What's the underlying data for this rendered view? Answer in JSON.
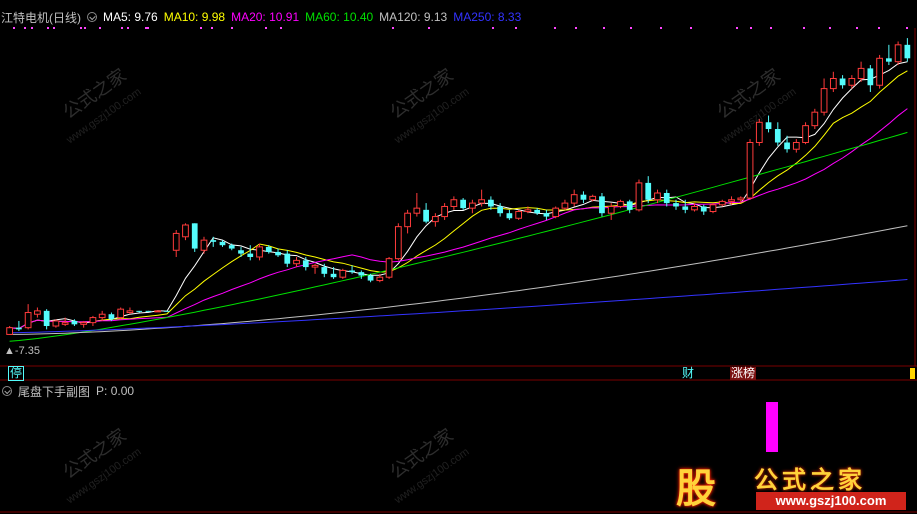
{
  "header": {
    "stock_name": "江特电机(日线)",
    "ma5": "MA5: 9.76",
    "ma10": "MA10: 9.98",
    "ma20": "MA20: 10.91",
    "ma60": "MA60: 10.40",
    "ma120": "MA120: 9.13",
    "ma250": "MA250: 8.33"
  },
  "colors": {
    "ma5": "#ffffff",
    "ma10": "#ffff00",
    "ma20": "#ff00ff",
    "ma60": "#00e000",
    "ma120": "#c0c0c0",
    "ma250": "#3333ff",
    "up": "#ff3b3b",
    "down": "#54fcfc",
    "grid": "#7a0000"
  },
  "price_marker": "7.35",
  "tags": {
    "left": "停",
    "cai": "财",
    "zhangbang": "涨榜"
  },
  "sub_panel": {
    "title": "尾盘下手副图",
    "value": "P: 0.00"
  },
  "watermark": {
    "text": "公式之家",
    "url": "www.gszj100.com"
  },
  "logo": {
    "char": "股",
    "text": "公式之家",
    "url": "www.gszj100.com"
  },
  "chart_data": {
    "type": "candlestick",
    "ohlc": [
      [
        7.3,
        7.55,
        7.3,
        7.5
      ],
      [
        7.5,
        7.7,
        7.4,
        7.45
      ],
      [
        7.5,
        8.2,
        7.45,
        7.95
      ],
      [
        7.9,
        8.1,
        7.8,
        8.0
      ],
      [
        8.0,
        8.05,
        7.45,
        7.55
      ],
      [
        7.55,
        7.75,
        7.5,
        7.7
      ],
      [
        7.6,
        7.8,
        7.55,
        7.65
      ],
      [
        7.7,
        7.75,
        7.55,
        7.6
      ],
      [
        7.6,
        7.7,
        7.5,
        7.65
      ],
      [
        7.65,
        7.85,
        7.55,
        7.8
      ],
      [
        7.8,
        8.0,
        7.7,
        7.9
      ],
      [
        7.9,
        7.95,
        7.7,
        7.75
      ],
      [
        7.8,
        8.1,
        7.75,
        8.05
      ],
      [
        7.95,
        8.1,
        7.9,
        8.0
      ],
      [
        8.0,
        8.0,
        7.95,
        7.98
      ],
      [
        8.0,
        8.0,
        7.98,
        7.99
      ],
      [
        8.0,
        8.0,
        7.99,
        8.0
      ],
      [
        8.0,
        8.0,
        7.99,
        7.99
      ],
      [
        9.8,
        10.4,
        9.6,
        10.3
      ],
      [
        10.2,
        10.6,
        10.1,
        10.55
      ],
      [
        10.6,
        10.6,
        9.75,
        9.85
      ],
      [
        9.8,
        10.2,
        9.7,
        10.1
      ],
      [
        10.1,
        10.2,
        9.9,
        10.05
      ],
      [
        10.05,
        10.1,
        9.9,
        9.95
      ],
      [
        9.95,
        10.0,
        9.8,
        9.85
      ],
      [
        9.8,
        9.9,
        9.6,
        9.7
      ],
      [
        9.7,
        9.95,
        9.5,
        9.6
      ],
      [
        9.6,
        10.0,
        9.5,
        9.9
      ],
      [
        9.9,
        9.95,
        9.7,
        9.75
      ],
      [
        9.75,
        9.85,
        9.6,
        9.65
      ],
      [
        9.7,
        9.8,
        9.3,
        9.4
      ],
      [
        9.4,
        9.6,
        9.3,
        9.5
      ],
      [
        9.5,
        9.6,
        9.2,
        9.3
      ],
      [
        9.3,
        9.4,
        9.1,
        9.35
      ],
      [
        9.3,
        9.4,
        9.0,
        9.1
      ],
      [
        9.1,
        9.3,
        8.95,
        9.0
      ],
      [
        9.0,
        9.25,
        8.95,
        9.2
      ],
      [
        9.2,
        9.35,
        9.1,
        9.15
      ],
      [
        9.15,
        9.2,
        8.95,
        9.05
      ],
      [
        9.05,
        9.1,
        8.85,
        8.9
      ],
      [
        8.9,
        9.1,
        8.85,
        9.0
      ],
      [
        9.0,
        9.6,
        8.95,
        9.55
      ],
      [
        9.55,
        10.6,
        9.5,
        10.5
      ],
      [
        10.5,
        11.0,
        10.3,
        10.9
      ],
      [
        10.9,
        11.5,
        10.8,
        11.05
      ],
      [
        11.0,
        11.2,
        10.6,
        10.65
      ],
      [
        10.65,
        10.9,
        10.5,
        10.8
      ],
      [
        10.8,
        11.2,
        10.7,
        11.1
      ],
      [
        11.1,
        11.4,
        11.0,
        11.3
      ],
      [
        11.3,
        11.35,
        11.0,
        11.05
      ],
      [
        11.05,
        11.3,
        10.9,
        11.2
      ],
      [
        11.2,
        11.6,
        11.1,
        11.3
      ],
      [
        11.3,
        11.4,
        11.0,
        11.1
      ],
      [
        11.1,
        11.2,
        10.8,
        10.9
      ],
      [
        10.9,
        11.0,
        10.7,
        10.75
      ],
      [
        10.75,
        11.0,
        10.7,
        10.95
      ],
      [
        10.95,
        11.1,
        10.9,
        11.0
      ],
      [
        11.0,
        11.05,
        10.85,
        10.9
      ],
      [
        10.9,
        11.0,
        10.7,
        10.8
      ],
      [
        10.8,
        11.1,
        10.75,
        11.05
      ],
      [
        11.05,
        11.3,
        11.0,
        11.2
      ],
      [
        11.2,
        11.6,
        11.1,
        11.45
      ],
      [
        11.45,
        11.55,
        11.2,
        11.3
      ],
      [
        11.3,
        11.45,
        11.25,
        11.4
      ],
      [
        11.4,
        11.5,
        10.8,
        10.9
      ],
      [
        10.9,
        11.2,
        10.7,
        11.1
      ],
      [
        11.1,
        11.3,
        11.05,
        11.25
      ],
      [
        11.25,
        11.3,
        10.9,
        11.0
      ],
      [
        11.0,
        11.9,
        10.95,
        11.8
      ],
      [
        11.8,
        12.0,
        11.2,
        11.3
      ],
      [
        11.3,
        11.6,
        11.2,
        11.5
      ],
      [
        11.5,
        11.6,
        11.1,
        11.2
      ],
      [
        11.2,
        11.3,
        11.0,
        11.1
      ],
      [
        11.1,
        11.3,
        10.9,
        11.0
      ],
      [
        11.0,
        11.2,
        10.95,
        11.1
      ],
      [
        11.1,
        11.15,
        10.85,
        10.95
      ],
      [
        10.95,
        11.2,
        10.9,
        11.15
      ],
      [
        11.15,
        11.3,
        11.1,
        11.25
      ],
      [
        11.25,
        11.4,
        11.15,
        11.3
      ],
      [
        11.3,
        11.4,
        11.2,
        11.35
      ],
      [
        11.35,
        13.1,
        11.3,
        13.0
      ],
      [
        13.0,
        13.7,
        12.9,
        13.6
      ],
      [
        13.6,
        13.8,
        13.3,
        13.4
      ],
      [
        13.4,
        13.6,
        12.9,
        13.0
      ],
      [
        13.0,
        13.2,
        12.7,
        12.8
      ],
      [
        12.8,
        13.1,
        12.7,
        13.0
      ],
      [
        13.0,
        13.6,
        12.95,
        13.5
      ],
      [
        13.5,
        14.0,
        13.4,
        13.9
      ],
      [
        13.9,
        14.9,
        13.8,
        14.6
      ],
      [
        14.6,
        15.1,
        14.5,
        14.9
      ],
      [
        14.9,
        15.0,
        14.6,
        14.7
      ],
      [
        14.7,
        15.0,
        14.6,
        14.9
      ],
      [
        14.9,
        15.4,
        14.8,
        15.2
      ],
      [
        15.2,
        15.3,
        14.5,
        14.7
      ],
      [
        14.7,
        15.6,
        14.6,
        15.5
      ],
      [
        15.5,
        15.9,
        15.3,
        15.4
      ],
      [
        15.4,
        16.0,
        15.3,
        15.9
      ],
      [
        15.9,
        16.1,
        15.4,
        15.5
      ]
    ],
    "ma_last": {
      "MA5": 9.76,
      "MA10": 9.98,
      "MA20": 10.91,
      "MA60": 10.4,
      "MA120": 9.13,
      "MA250": 8.33
    }
  }
}
